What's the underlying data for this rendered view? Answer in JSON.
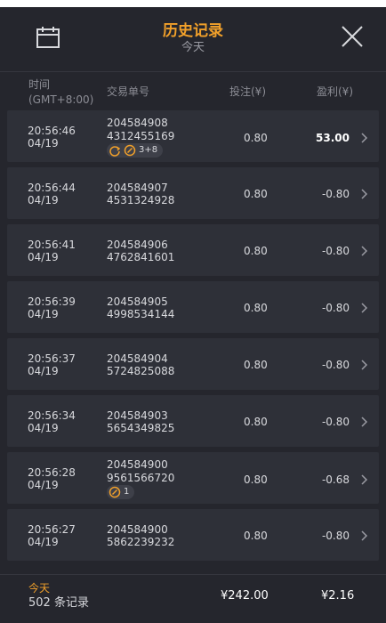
{
  "header": {
    "title": "历史记录",
    "subtitle": "今天"
  },
  "columns": {
    "time": "时间",
    "timezone": "(GMT+8:00)",
    "order": "交易单号",
    "stake": "投注(¥)",
    "profit": "盈利(¥)"
  },
  "rows": [
    {
      "time": "20:56:46",
      "date": "04/19",
      "order1": "204584908",
      "order2": "4312455169",
      "stake": "0.80",
      "profit": "53.00",
      "badge": "3+8"
    },
    {
      "time": "20:56:44",
      "date": "04/19",
      "order1": "204584907",
      "order2": "4531324928",
      "stake": "0.80",
      "profit": "-0.80"
    },
    {
      "time": "20:56:41",
      "date": "04/19",
      "order1": "204584906",
      "order2": "4762841601",
      "stake": "0.80",
      "profit": "-0.80"
    },
    {
      "time": "20:56:39",
      "date": "04/19",
      "order1": "204584905",
      "order2": "4998534144",
      "stake": "0.80",
      "profit": "-0.80"
    },
    {
      "time": "20:56:37",
      "date": "04/19",
      "order1": "204584904",
      "order2": "5724825088",
      "stake": "0.80",
      "profit": "-0.80"
    },
    {
      "time": "20:56:34",
      "date": "04/19",
      "order1": "204584903",
      "order2": "5654349825",
      "stake": "0.80",
      "profit": "-0.80"
    },
    {
      "time": "20:56:28",
      "date": "04/19",
      "order1": "204584900",
      "order2": "9561566720",
      "stake": "0.80",
      "profit": "-0.68",
      "badge": "1"
    },
    {
      "time": "20:56:27",
      "date": "04/19",
      "order1": "204584900",
      "order2": "5862239232",
      "stake": "0.80",
      "profit": "-0.80"
    }
  ],
  "footer": {
    "period": "今天",
    "count": "502 条记录",
    "total_stake": "¥242.00",
    "total_profit": "¥2.16"
  },
  "colors": {
    "accent": "#f1a02a",
    "background": "#25262d",
    "row": "#2e3038"
  }
}
